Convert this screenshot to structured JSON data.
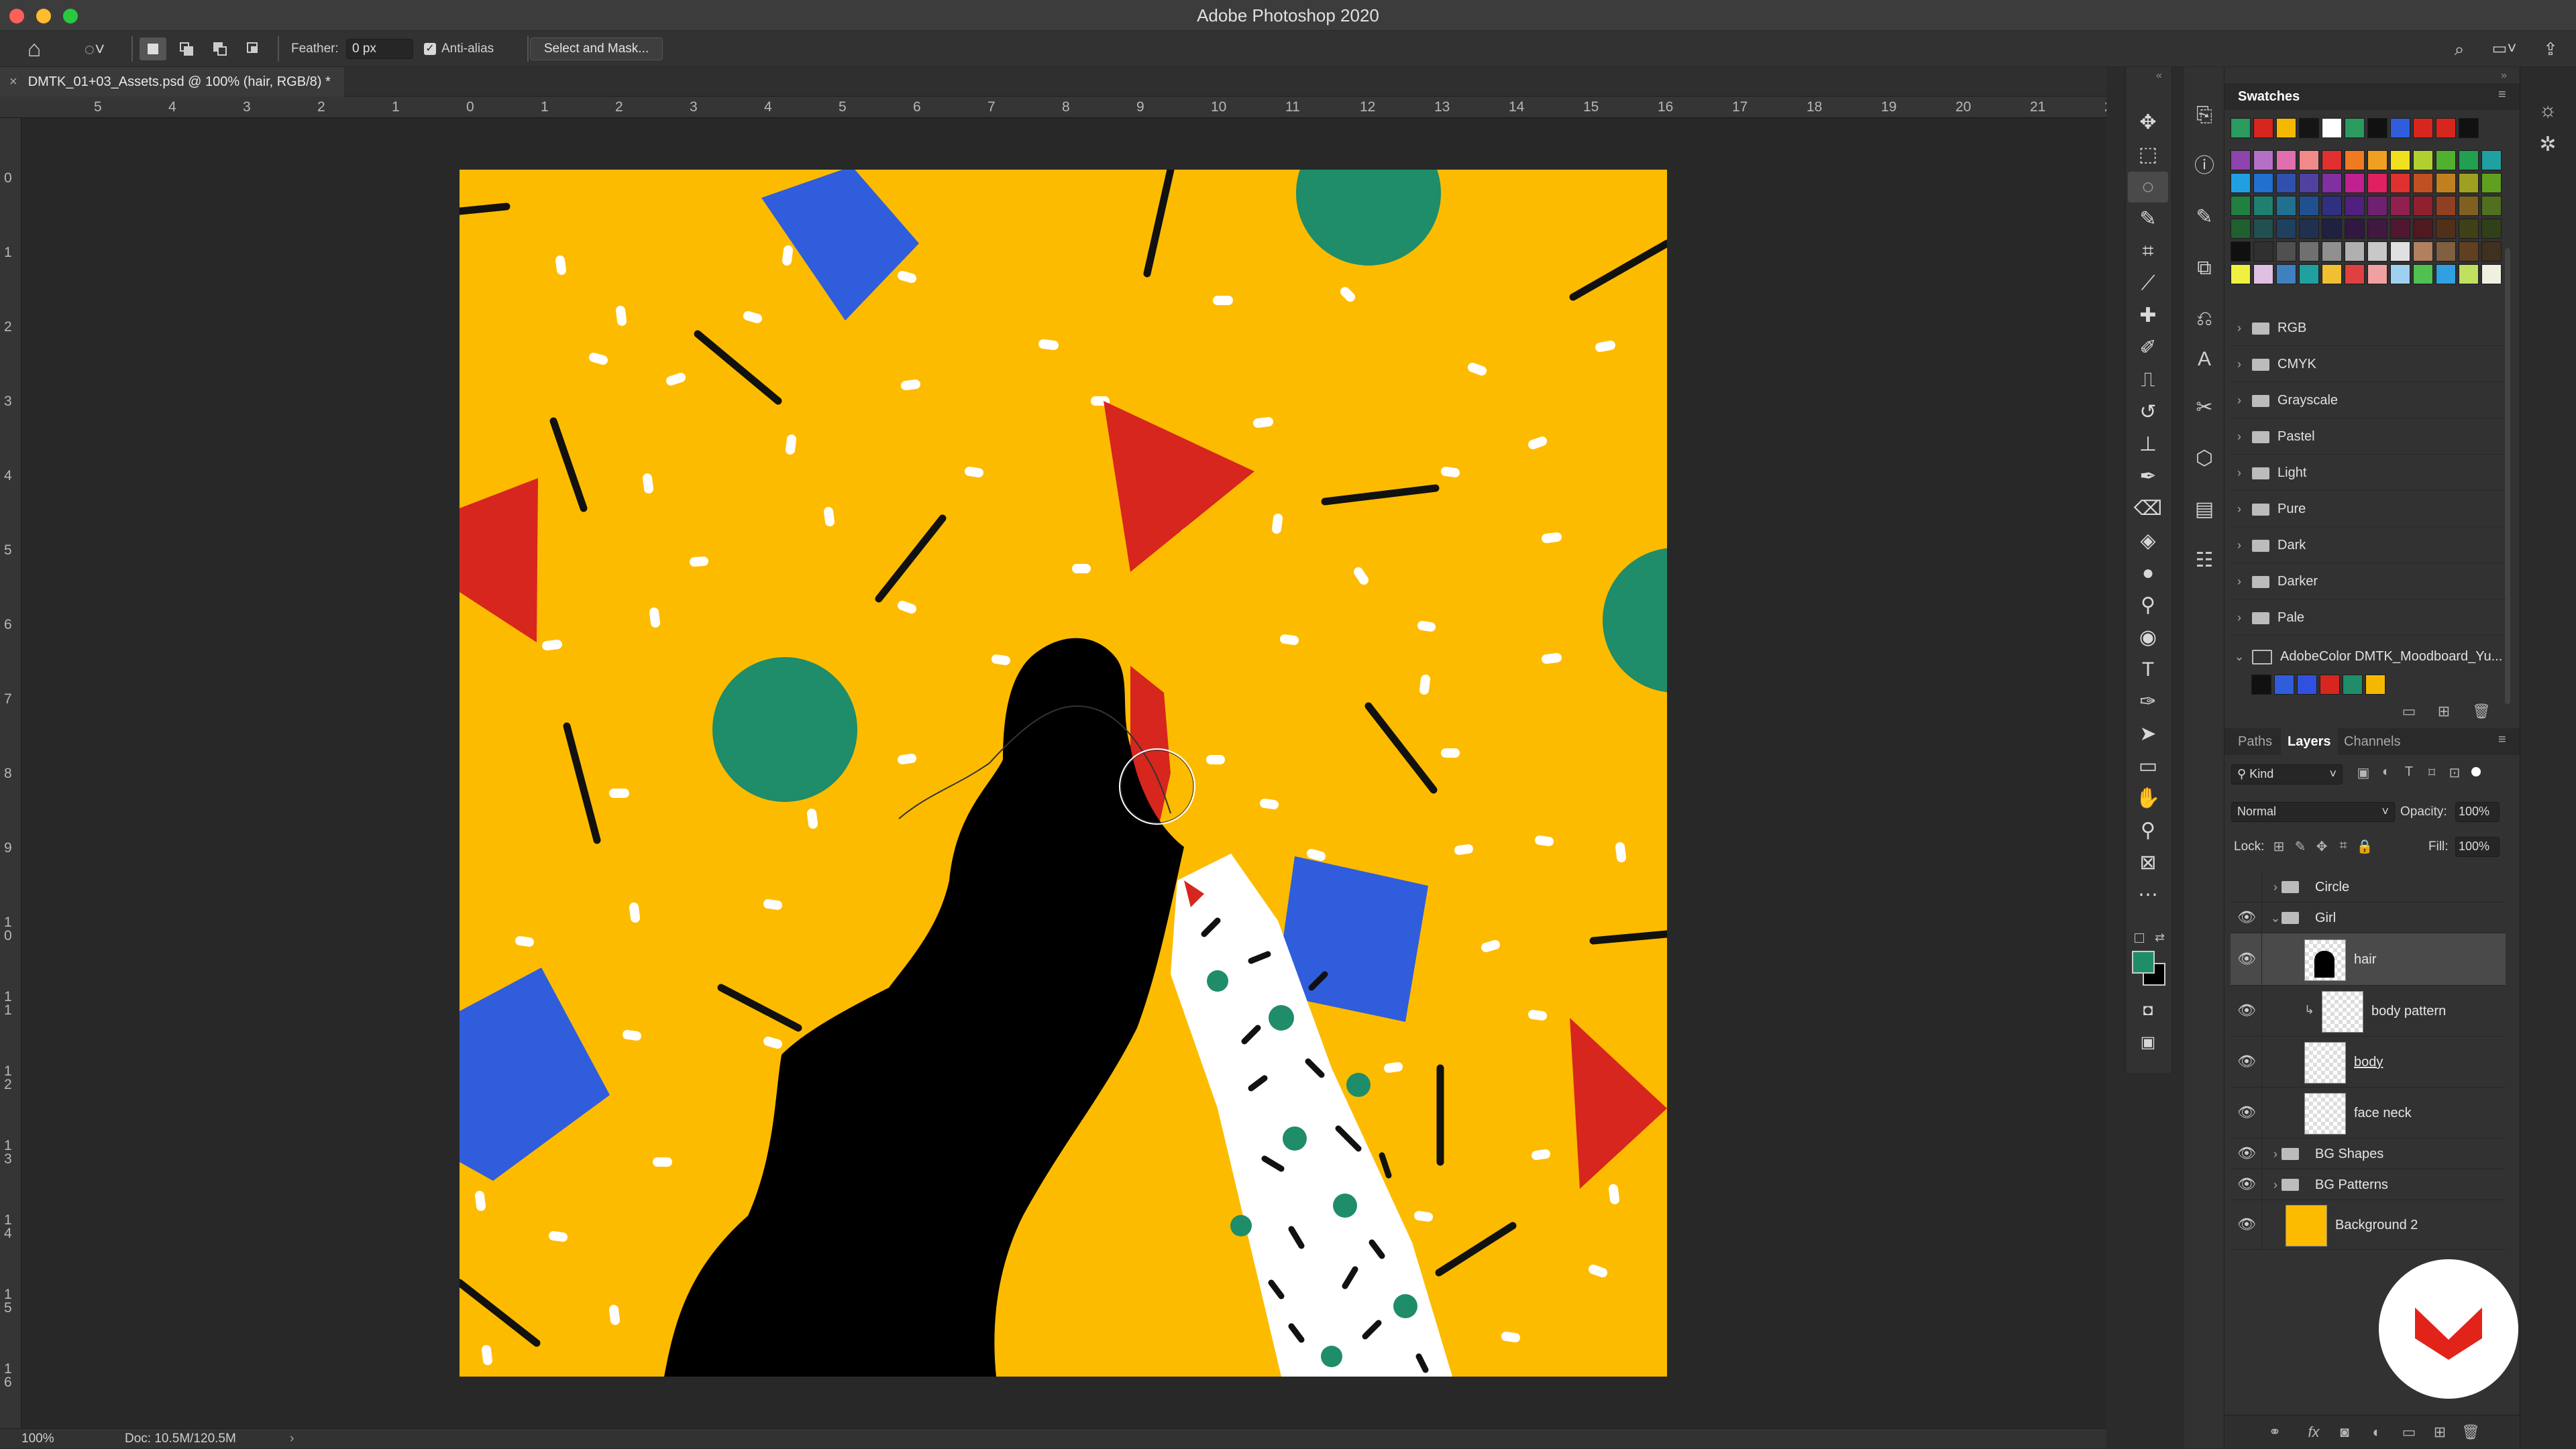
{
  "window": {
    "title": "Adobe Photoshop 2020"
  },
  "options_bar": {
    "feather_label": "Feather:",
    "feather_value": "0 px",
    "antialias_label": "Anti-alias",
    "antialias_checked": true,
    "select_mask_button": "Select and Mask..."
  },
  "document": {
    "tab_title": "DMTK_01+03_Assets.psd @ 100% (hair, RGB/8) *",
    "zoom": "100%",
    "doc_size": "Doc: 10.5M/120.5M"
  },
  "rulers": {
    "horizontal": [
      "5",
      "4",
      "3",
      "2",
      "1",
      "0",
      "1",
      "2",
      "3",
      "4",
      "5",
      "6",
      "7",
      "8",
      "9",
      "10",
      "11",
      "12",
      "13",
      "14",
      "15",
      "16",
      "17",
      "18",
      "19",
      "20",
      "21",
      "2"
    ],
    "vertical": [
      "0",
      "1",
      "2",
      "3",
      "4",
      "5",
      "6",
      "7",
      "8",
      "9",
      "10",
      "11",
      "12",
      "13",
      "14",
      "15",
      "16"
    ]
  },
  "swatches": {
    "tab": "Swatches",
    "recent": [
      "#2a9a5e",
      "#d7261e",
      "#f5b800",
      "#151515",
      "#ffffff",
      "#2a9a5e",
      "#111111",
      "#2f5ddc",
      "#d7261e",
      "#d7261e",
      "#111111"
    ],
    "grid": [
      [
        "#8e44ad",
        "#b370c5",
        "#e06fb0",
        "#f08a8a",
        "#e03030",
        "#f07a20",
        "#f0a020",
        "#f0e020",
        "#b0d030",
        "#50b030",
        "#20a050",
        "#20a0a0"
      ],
      [
        "#20a0e0",
        "#2070d0",
        "#3050b0",
        "#5040a0",
        "#8030a0",
        "#c02090",
        "#e02060",
        "#e03030",
        "#c05020",
        "#c08020",
        "#a0a020",
        "#60a020"
      ],
      [
        "#208040",
        "#208070",
        "#207090",
        "#205090",
        "#303080",
        "#502080",
        "#702070",
        "#902050",
        "#902030",
        "#904020",
        "#806020",
        "#507020"
      ],
      [
        "#206030",
        "#205050",
        "#204060",
        "#203050",
        "#202040",
        "#301840",
        "#401840",
        "#501830",
        "#501820",
        "#503018",
        "#404018",
        "#304018"
      ],
      [
        "#101010",
        "#303030",
        "#505050",
        "#707070",
        "#909090",
        "#b0b0b0",
        "#c8c8c8",
        "#e0e0e0",
        "#b08060",
        "#806040",
        "#604020",
        "#403020"
      ],
      [
        "#f0f040",
        "#e0c0e0",
        "#4080c0",
        "#20a0a0",
        "#f0c030",
        "#e04040",
        "#f0a0a0",
        "#a0d0f0",
        "#50c050",
        "#30a0e0",
        "#c0e060",
        "#f0f0e0"
      ]
    ],
    "groups": [
      "RGB",
      "CMYK",
      "Grayscale",
      "Pastel",
      "Light",
      "Pure",
      "Dark",
      "Darker",
      "Pale"
    ],
    "open_group": "AdobeColor DMTK_Moodboard_Yu...",
    "open_group_colors": [
      "#111111",
      "#2f5ddc",
      "#3050e0",
      "#d7261e",
      "#1f8c6a",
      "#f5b800"
    ]
  },
  "layers_panel": {
    "tabs": [
      "Paths",
      "Layers",
      "Channels"
    ],
    "active_tab": "Layers",
    "filter_label": "Kind",
    "blend_mode": "Normal",
    "opacity_label": "Opacity:",
    "opacity_value": "100%",
    "lock_label": "Lock:",
    "fill_label": "Fill:",
    "fill_value": "100%",
    "layers": [
      {
        "name": "Circle",
        "type": "group",
        "visible": false,
        "expanded": false,
        "indent": 0
      },
      {
        "name": "Girl",
        "type": "group",
        "visible": true,
        "expanded": true,
        "indent": 0
      },
      {
        "name": "hair",
        "type": "layer",
        "visible": true,
        "selected": true,
        "indent": 1
      },
      {
        "name": "body pattern",
        "type": "layer",
        "visible": true,
        "clipped": true,
        "indent": 1
      },
      {
        "name": "body",
        "type": "layer",
        "visible": true,
        "indent": 1
      },
      {
        "name": "face neck",
        "type": "layer",
        "visible": true,
        "indent": 1
      },
      {
        "name": "BG Shapes",
        "type": "group",
        "visible": true,
        "expanded": false,
        "indent": 0
      },
      {
        "name": "BG Patterns",
        "type": "group",
        "visible": true,
        "expanded": false,
        "indent": 0
      },
      {
        "name": "Background 2",
        "type": "layer",
        "visible": true,
        "indent": 0,
        "thumb_color": "#fdbb00"
      }
    ]
  },
  "colors": {
    "canvas_bg": "#fdbb00",
    "foreground": "#1f8c6a",
    "background": "#000000",
    "accent_red": "#d7261e",
    "accent_blue": "#2f5ddc",
    "accent_green": "#1f8c6a"
  }
}
